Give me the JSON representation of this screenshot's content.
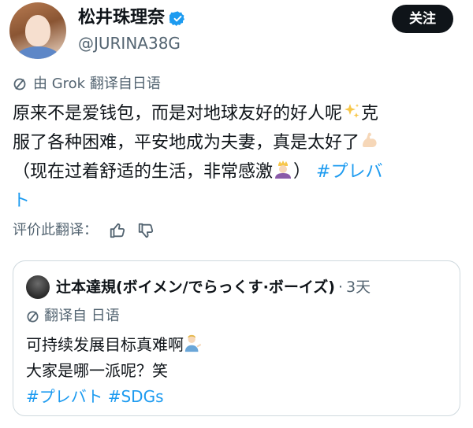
{
  "author": {
    "display_name": "松井珠理奈",
    "handle": "@JURINA38G",
    "verified_icon": "verified-badge-icon"
  },
  "follow_label": "关注",
  "translation": {
    "label": "由 Grok 翻译自日语",
    "icon": "translate-icon"
  },
  "tweet": {
    "line1": "原来不是爱钱包，而是对地球友好的好人呢",
    "line1b": "克",
    "line2": "服了各种困难，平安地成为夫妻，真是太好了",
    "line3": "（现在过着舒适的生活，非常感激",
    "line3b": "）",
    "hashtag_part1": "#プレバ",
    "hashtag_part2": "ト",
    "emojis": [
      "sparkles-emoji",
      "flexed-biceps-emoji",
      "person-with-crown-emoji"
    ]
  },
  "rate": {
    "label": "评价此翻译：",
    "like_icon": "thumbs-up-icon",
    "dislike_icon": "thumbs-down-icon"
  },
  "quote": {
    "author_name": "辻本達規(ボイメン/でらっくす·ボーイズ)",
    "separator": "·",
    "time": "3天",
    "translation_label": "翻译自 日语",
    "line1": "可持续发展目标真难啊",
    "line2": "大家是哪一派呢？笑",
    "hashtags": "#プレバト #SDGs",
    "emoji": "person-tipping-hand-emoji"
  },
  "colors": {
    "text": "#0f1419",
    "secondary": "#536471",
    "link": "#1d9bf0",
    "border": "#cfd9de",
    "button": "#0f1419"
  }
}
